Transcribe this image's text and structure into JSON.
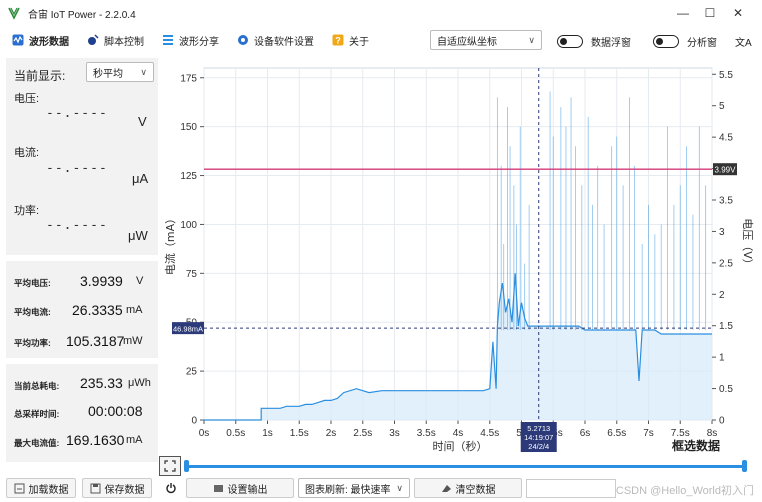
{
  "window": {
    "title": "合宙 IoT Power - 2.2.0.4"
  },
  "toolbar": {
    "items": [
      {
        "label": "波形数据",
        "icon": "waveform-icon"
      },
      {
        "label": "脚本控制",
        "icon": "script-icon"
      },
      {
        "label": "波形分享",
        "icon": "list-icon"
      },
      {
        "label": "设备软件设置",
        "icon": "settings-icon"
      },
      {
        "label": "关于",
        "icon": "help-icon"
      }
    ],
    "axis_mode": "自适应纵坐标",
    "toggle_float_label": "数据浮窗",
    "toggle_analysis_label": "分析窗",
    "lang_icon": "文A"
  },
  "left": {
    "display_label": "当前显示:",
    "display_mode": "秒平均",
    "voltage": {
      "label": "电压:",
      "value": "--.----",
      "unit": "V"
    },
    "current": {
      "label": "电流:",
      "value": "--.----",
      "unit": "μA"
    },
    "power": {
      "label": "功率:",
      "value": "--.----",
      "unit": "μW"
    },
    "avg": {
      "voltage": {
        "label": "平均电压:",
        "value": "3.9939",
        "unit": "V"
      },
      "current": {
        "label": "平均电流:",
        "value": "26.3335",
        "unit": "mA"
      },
      "power": {
        "label": "平均功率:",
        "value": "105.3187",
        "unit": "mW"
      }
    },
    "totals": {
      "energy": {
        "label": "当前总耗电:",
        "value": "235.33",
        "unit": "μWh"
      },
      "time": {
        "label": "总采样时间:",
        "value": "00:00:08",
        "unit": ""
      },
      "max_current": {
        "label": "最大电流值:",
        "value": "169.1630",
        "unit": "mA"
      }
    }
  },
  "chart_data": {
    "type": "line",
    "xlabel": "时间（秒）",
    "ylabel_left": "电流（mA）",
    "ylabel_right": "电压（V）",
    "x_ticks": [
      "0s",
      "0.5s",
      "1s",
      "1.5s",
      "2s",
      "2.5s",
      "3s",
      "3.5s",
      "4s",
      "4.5s",
      "5s",
      "5.5s",
      "6s",
      "6.5s",
      "7s",
      "7.5s",
      "8s"
    ],
    "xlim": [
      0,
      8
    ],
    "ylim_left": [
      0,
      180
    ],
    "y_ticks_left": [
      0,
      25,
      50,
      75,
      100,
      125,
      150,
      175
    ],
    "ylim_right": [
      0,
      5.6
    ],
    "y_ticks_right": [
      0,
      0.5,
      1,
      1.5,
      2,
      2.5,
      3,
      3.5,
      4,
      4.5,
      5,
      5.5
    ],
    "voltage_line": {
      "value": 3.99,
      "label": "3.99V",
      "color": "#d63a78"
    },
    "cursor_h": {
      "value_mA": 46.98,
      "label": "46.98mA"
    },
    "cursor_v": {
      "x": 5.2713,
      "label_lines": [
        "5.2713",
        "14:19:07",
        "24/2/4"
      ]
    },
    "series_color": "#2a8fe0",
    "grid": true,
    "corner_label": "框选数据",
    "current_series": {
      "x": [
        0,
        0.9,
        0.9,
        1.2,
        1.3,
        1.35,
        1.4,
        1.5,
        1.6,
        1.7,
        1.8,
        1.9,
        2.0,
        2.1,
        2.2,
        2.4,
        2.6,
        2.8,
        3.0,
        3.3,
        3.6,
        3.9,
        4.2,
        4.4,
        4.5,
        4.55,
        4.6,
        4.62,
        4.65,
        4.7,
        4.75,
        4.8,
        4.85,
        4.9,
        4.95,
        5.0,
        5.05,
        5.1,
        5.2,
        5.3,
        5.4,
        5.5,
        5.6,
        5.7,
        5.8,
        5.9,
        6.0,
        6.1,
        6.2,
        6.3,
        6.4,
        6.5,
        6.6,
        6.7,
        6.8,
        6.85,
        6.9,
        7.0,
        7.1,
        7.2,
        7.3,
        7.4,
        7.5,
        7.6,
        7.7,
        7.8,
        7.9,
        8.0
      ],
      "y": [
        0,
        0,
        6,
        6,
        7,
        7,
        7,
        7,
        8,
        8,
        9,
        10,
        10,
        11,
        14,
        16,
        14,
        15,
        15,
        15,
        15,
        15,
        15,
        15,
        16,
        40,
        16,
        48,
        60,
        70,
        55,
        62,
        50,
        75,
        48,
        60,
        52,
        48,
        48,
        48,
        48,
        48,
        48,
        48,
        48,
        48,
        46,
        46,
        46,
        46,
        46,
        46,
        46,
        46,
        46,
        20,
        46,
        46,
        46,
        44,
        44,
        44,
        44,
        44,
        44,
        44,
        44,
        44
      ]
    }
  },
  "bottom": {
    "load_button": "加载数据",
    "save_button": "保存数据",
    "settings_output": "设置输出",
    "refresh_label": "图表刷新: 最快速率",
    "clear_button": "清空数据",
    "watermark": "CSDN @Hello_World初入门"
  }
}
